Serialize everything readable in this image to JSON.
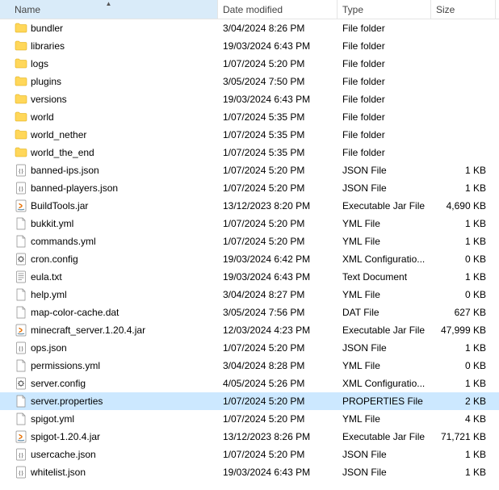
{
  "columns": {
    "name": "Name",
    "date": "Date modified",
    "type": "Type",
    "size": "Size"
  },
  "sort_column": "name",
  "selected_index": 21,
  "files": [
    {
      "icon": "folder",
      "name": "bundler",
      "date": "3/04/2024 8:26 PM",
      "type": "File folder",
      "size": ""
    },
    {
      "icon": "folder",
      "name": "libraries",
      "date": "19/03/2024 6:43 PM",
      "type": "File folder",
      "size": ""
    },
    {
      "icon": "folder",
      "name": "logs",
      "date": "1/07/2024 5:20 PM",
      "type": "File folder",
      "size": ""
    },
    {
      "icon": "folder",
      "name": "plugins",
      "date": "3/05/2024 7:50 PM",
      "type": "File folder",
      "size": ""
    },
    {
      "icon": "folder",
      "name": "versions",
      "date": "19/03/2024 6:43 PM",
      "type": "File folder",
      "size": ""
    },
    {
      "icon": "folder",
      "name": "world",
      "date": "1/07/2024 5:35 PM",
      "type": "File folder",
      "size": ""
    },
    {
      "icon": "folder",
      "name": "world_nether",
      "date": "1/07/2024 5:35 PM",
      "type": "File folder",
      "size": ""
    },
    {
      "icon": "folder",
      "name": "world_the_end",
      "date": "1/07/2024 5:35 PM",
      "type": "File folder",
      "size": ""
    },
    {
      "icon": "json",
      "name": "banned-ips.json",
      "date": "1/07/2024 5:20 PM",
      "type": "JSON File",
      "size": "1 KB"
    },
    {
      "icon": "json",
      "name": "banned-players.json",
      "date": "1/07/2024 5:20 PM",
      "type": "JSON File",
      "size": "1 KB"
    },
    {
      "icon": "jar",
      "name": "BuildTools.jar",
      "date": "13/12/2023 8:20 PM",
      "type": "Executable Jar File",
      "size": "4,690 KB"
    },
    {
      "icon": "file",
      "name": "bukkit.yml",
      "date": "1/07/2024 5:20 PM",
      "type": "YML File",
      "size": "1 KB"
    },
    {
      "icon": "file",
      "name": "commands.yml",
      "date": "1/07/2024 5:20 PM",
      "type": "YML File",
      "size": "1 KB"
    },
    {
      "icon": "config",
      "name": "cron.config",
      "date": "19/03/2024 6:42 PM",
      "type": "XML Configuratio...",
      "size": "0 KB"
    },
    {
      "icon": "text",
      "name": "eula.txt",
      "date": "19/03/2024 6:43 PM",
      "type": "Text Document",
      "size": "1 KB"
    },
    {
      "icon": "file",
      "name": "help.yml",
      "date": "3/04/2024 8:27 PM",
      "type": "YML File",
      "size": "0 KB"
    },
    {
      "icon": "file",
      "name": "map-color-cache.dat",
      "date": "3/05/2024 7:56 PM",
      "type": "DAT File",
      "size": "627 KB"
    },
    {
      "icon": "jar",
      "name": "minecraft_server.1.20.4.jar",
      "date": "12/03/2024 4:23 PM",
      "type": "Executable Jar File",
      "size": "47,999 KB"
    },
    {
      "icon": "json",
      "name": "ops.json",
      "date": "1/07/2024 5:20 PM",
      "type": "JSON File",
      "size": "1 KB"
    },
    {
      "icon": "file",
      "name": "permissions.yml",
      "date": "3/04/2024 8:28 PM",
      "type": "YML File",
      "size": "0 KB"
    },
    {
      "icon": "config",
      "name": "server.config",
      "date": "4/05/2024 5:26 PM",
      "type": "XML Configuratio...",
      "size": "1 KB"
    },
    {
      "icon": "file",
      "name": "server.properties",
      "date": "1/07/2024 5:20 PM",
      "type": "PROPERTIES File",
      "size": "2 KB"
    },
    {
      "icon": "file",
      "name": "spigot.yml",
      "date": "1/07/2024 5:20 PM",
      "type": "YML File",
      "size": "4 KB"
    },
    {
      "icon": "jar",
      "name": "spigot-1.20.4.jar",
      "date": "13/12/2023 8:26 PM",
      "type": "Executable Jar File",
      "size": "71,721 KB"
    },
    {
      "icon": "json",
      "name": "usercache.json",
      "date": "1/07/2024 5:20 PM",
      "type": "JSON File",
      "size": "1 KB"
    },
    {
      "icon": "json",
      "name": "whitelist.json",
      "date": "19/03/2024 6:43 PM",
      "type": "JSON File",
      "size": "1 KB"
    }
  ]
}
